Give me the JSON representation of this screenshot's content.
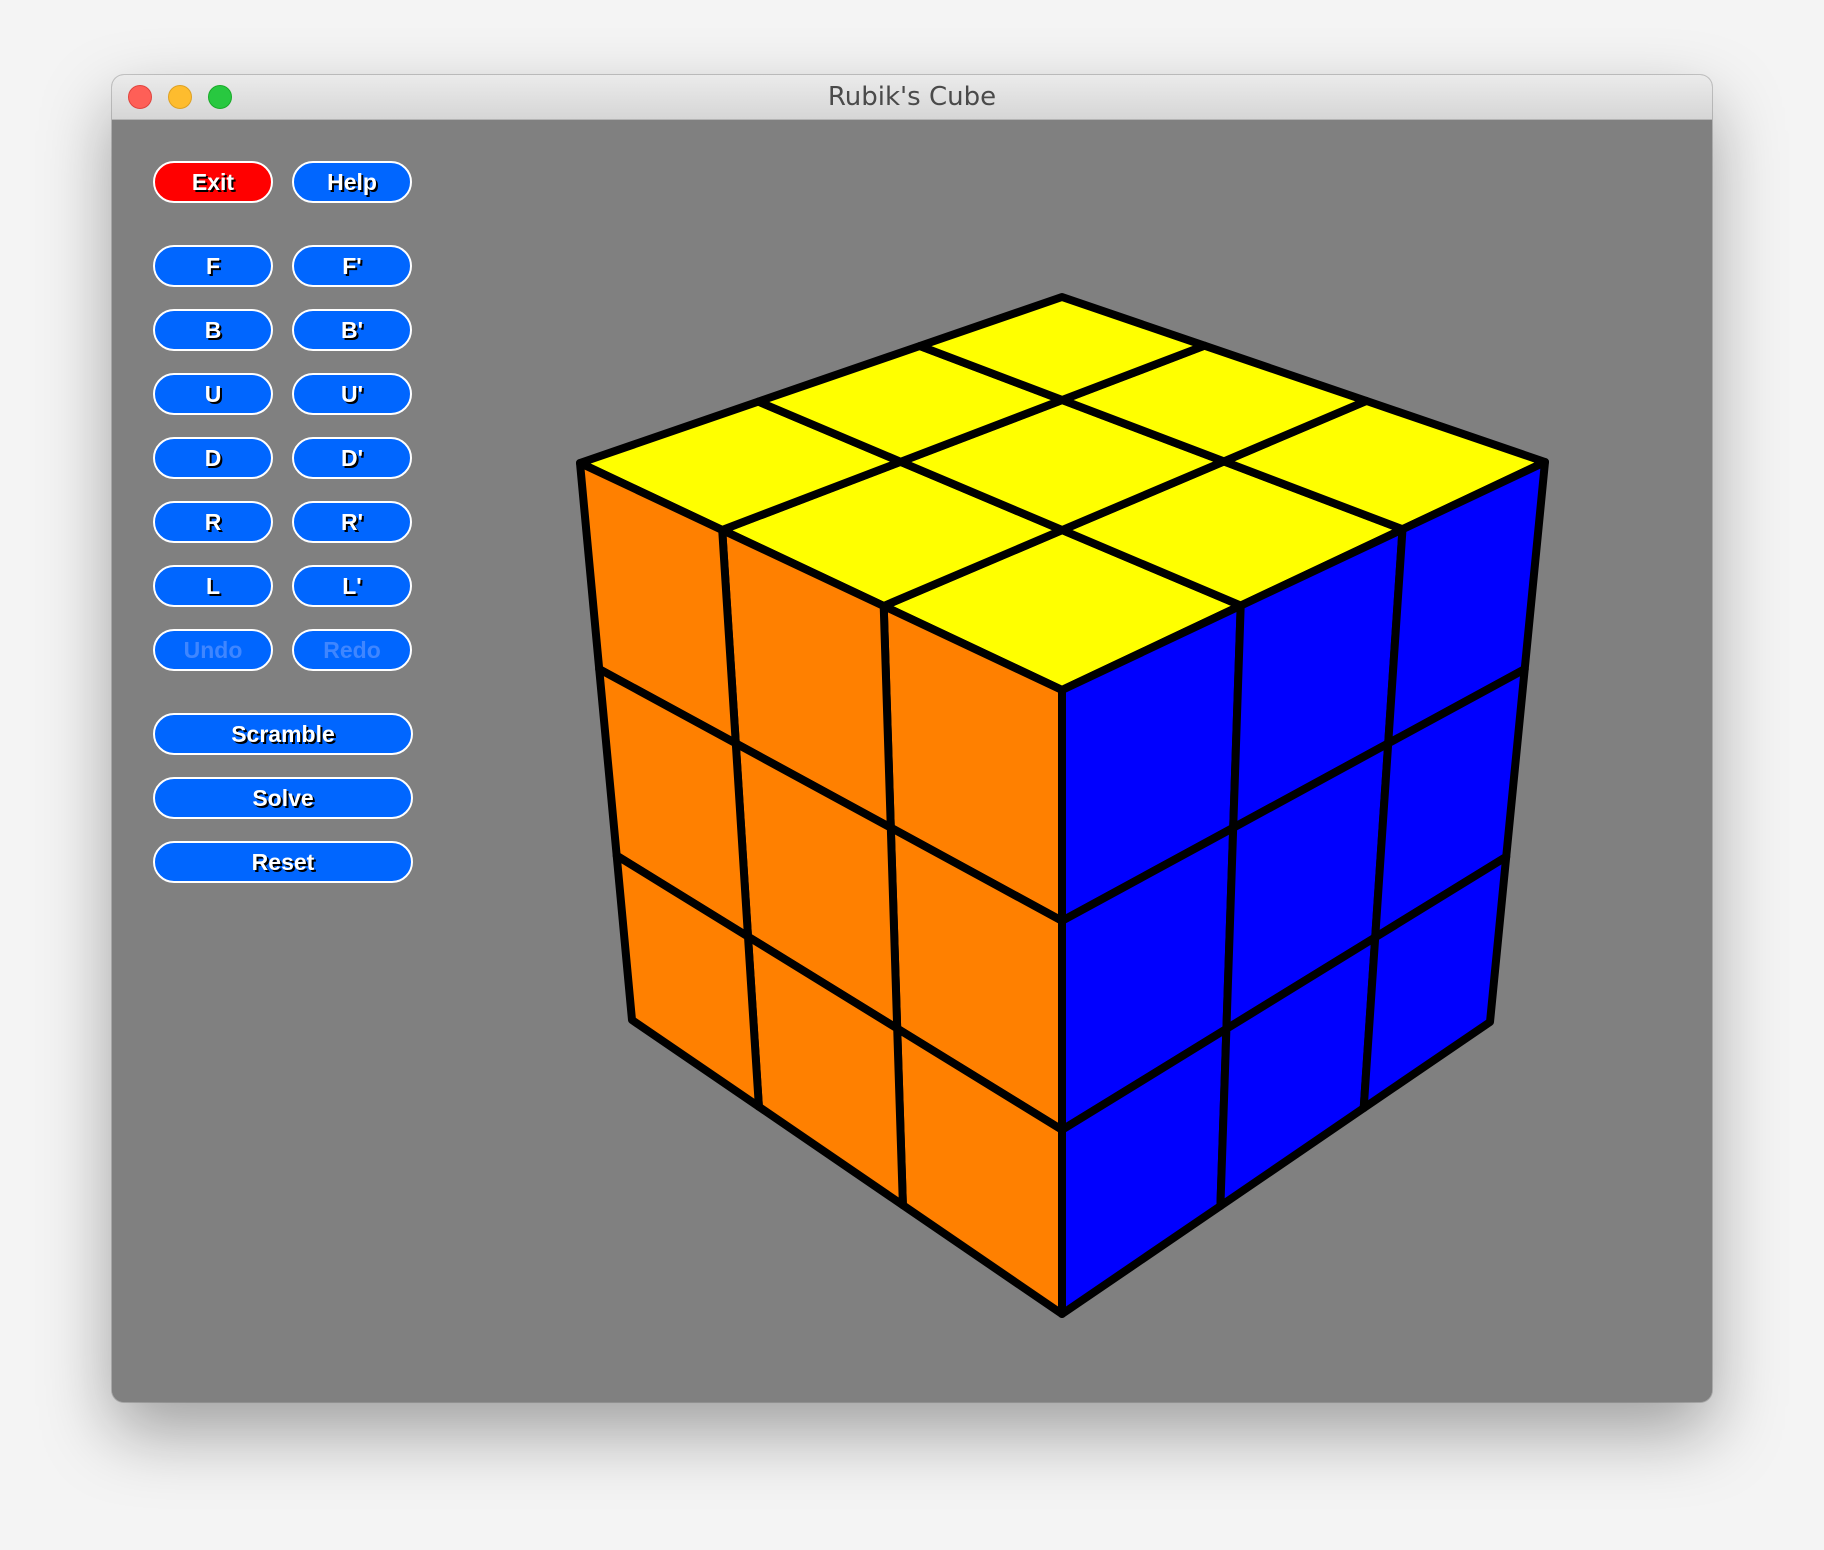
{
  "window": {
    "title": "Rubik's Cube",
    "controls": [
      "close",
      "minimize",
      "zoom"
    ]
  },
  "buttons": {
    "exit": "Exit",
    "help": "Help",
    "moves": [
      {
        "name": "F",
        "label": "F"
      },
      {
        "name": "F-prime",
        "label": "F'"
      },
      {
        "name": "B",
        "label": "B"
      },
      {
        "name": "B-prime",
        "label": "B'"
      },
      {
        "name": "U",
        "label": "U"
      },
      {
        "name": "U-prime",
        "label": "U'"
      },
      {
        "name": "D",
        "label": "D"
      },
      {
        "name": "D-prime",
        "label": "D'"
      },
      {
        "name": "R",
        "label": "R"
      },
      {
        "name": "R-prime",
        "label": "R'"
      },
      {
        "name": "L",
        "label": "L"
      },
      {
        "name": "L-prime",
        "label": "L'"
      }
    ],
    "undo": "Undo",
    "redo": "Redo",
    "undo_enabled": false,
    "redo_enabled": false,
    "scramble": "Scramble",
    "solve": "Solve",
    "reset": "Reset"
  },
  "colors": {
    "background": "#808080",
    "button": "#0066ff",
    "exit_button": "#ff0000",
    "disabled_text": "#3f86ff",
    "sticker_outline": "#000000"
  },
  "cube": {
    "visible_faces": {
      "top": {
        "color_name": "yellow",
        "color": "#ffff00",
        "stickers": [
          [
            "yellow",
            "yellow",
            "yellow"
          ],
          [
            "yellow",
            "yellow",
            "yellow"
          ],
          [
            "yellow",
            "yellow",
            "yellow"
          ]
        ]
      },
      "left": {
        "color_name": "orange",
        "color": "#ff8000",
        "stickers": [
          [
            "orange",
            "orange",
            "orange"
          ],
          [
            "orange",
            "orange",
            "orange"
          ],
          [
            "orange",
            "orange",
            "orange"
          ]
        ]
      },
      "right": {
        "color_name": "blue",
        "color": "#0000ff",
        "stickers": [
          [
            "blue",
            "blue",
            "blue"
          ],
          [
            "blue",
            "blue",
            "blue"
          ],
          [
            "blue",
            "blue",
            "blue"
          ]
        ]
      }
    },
    "state": "solved"
  }
}
